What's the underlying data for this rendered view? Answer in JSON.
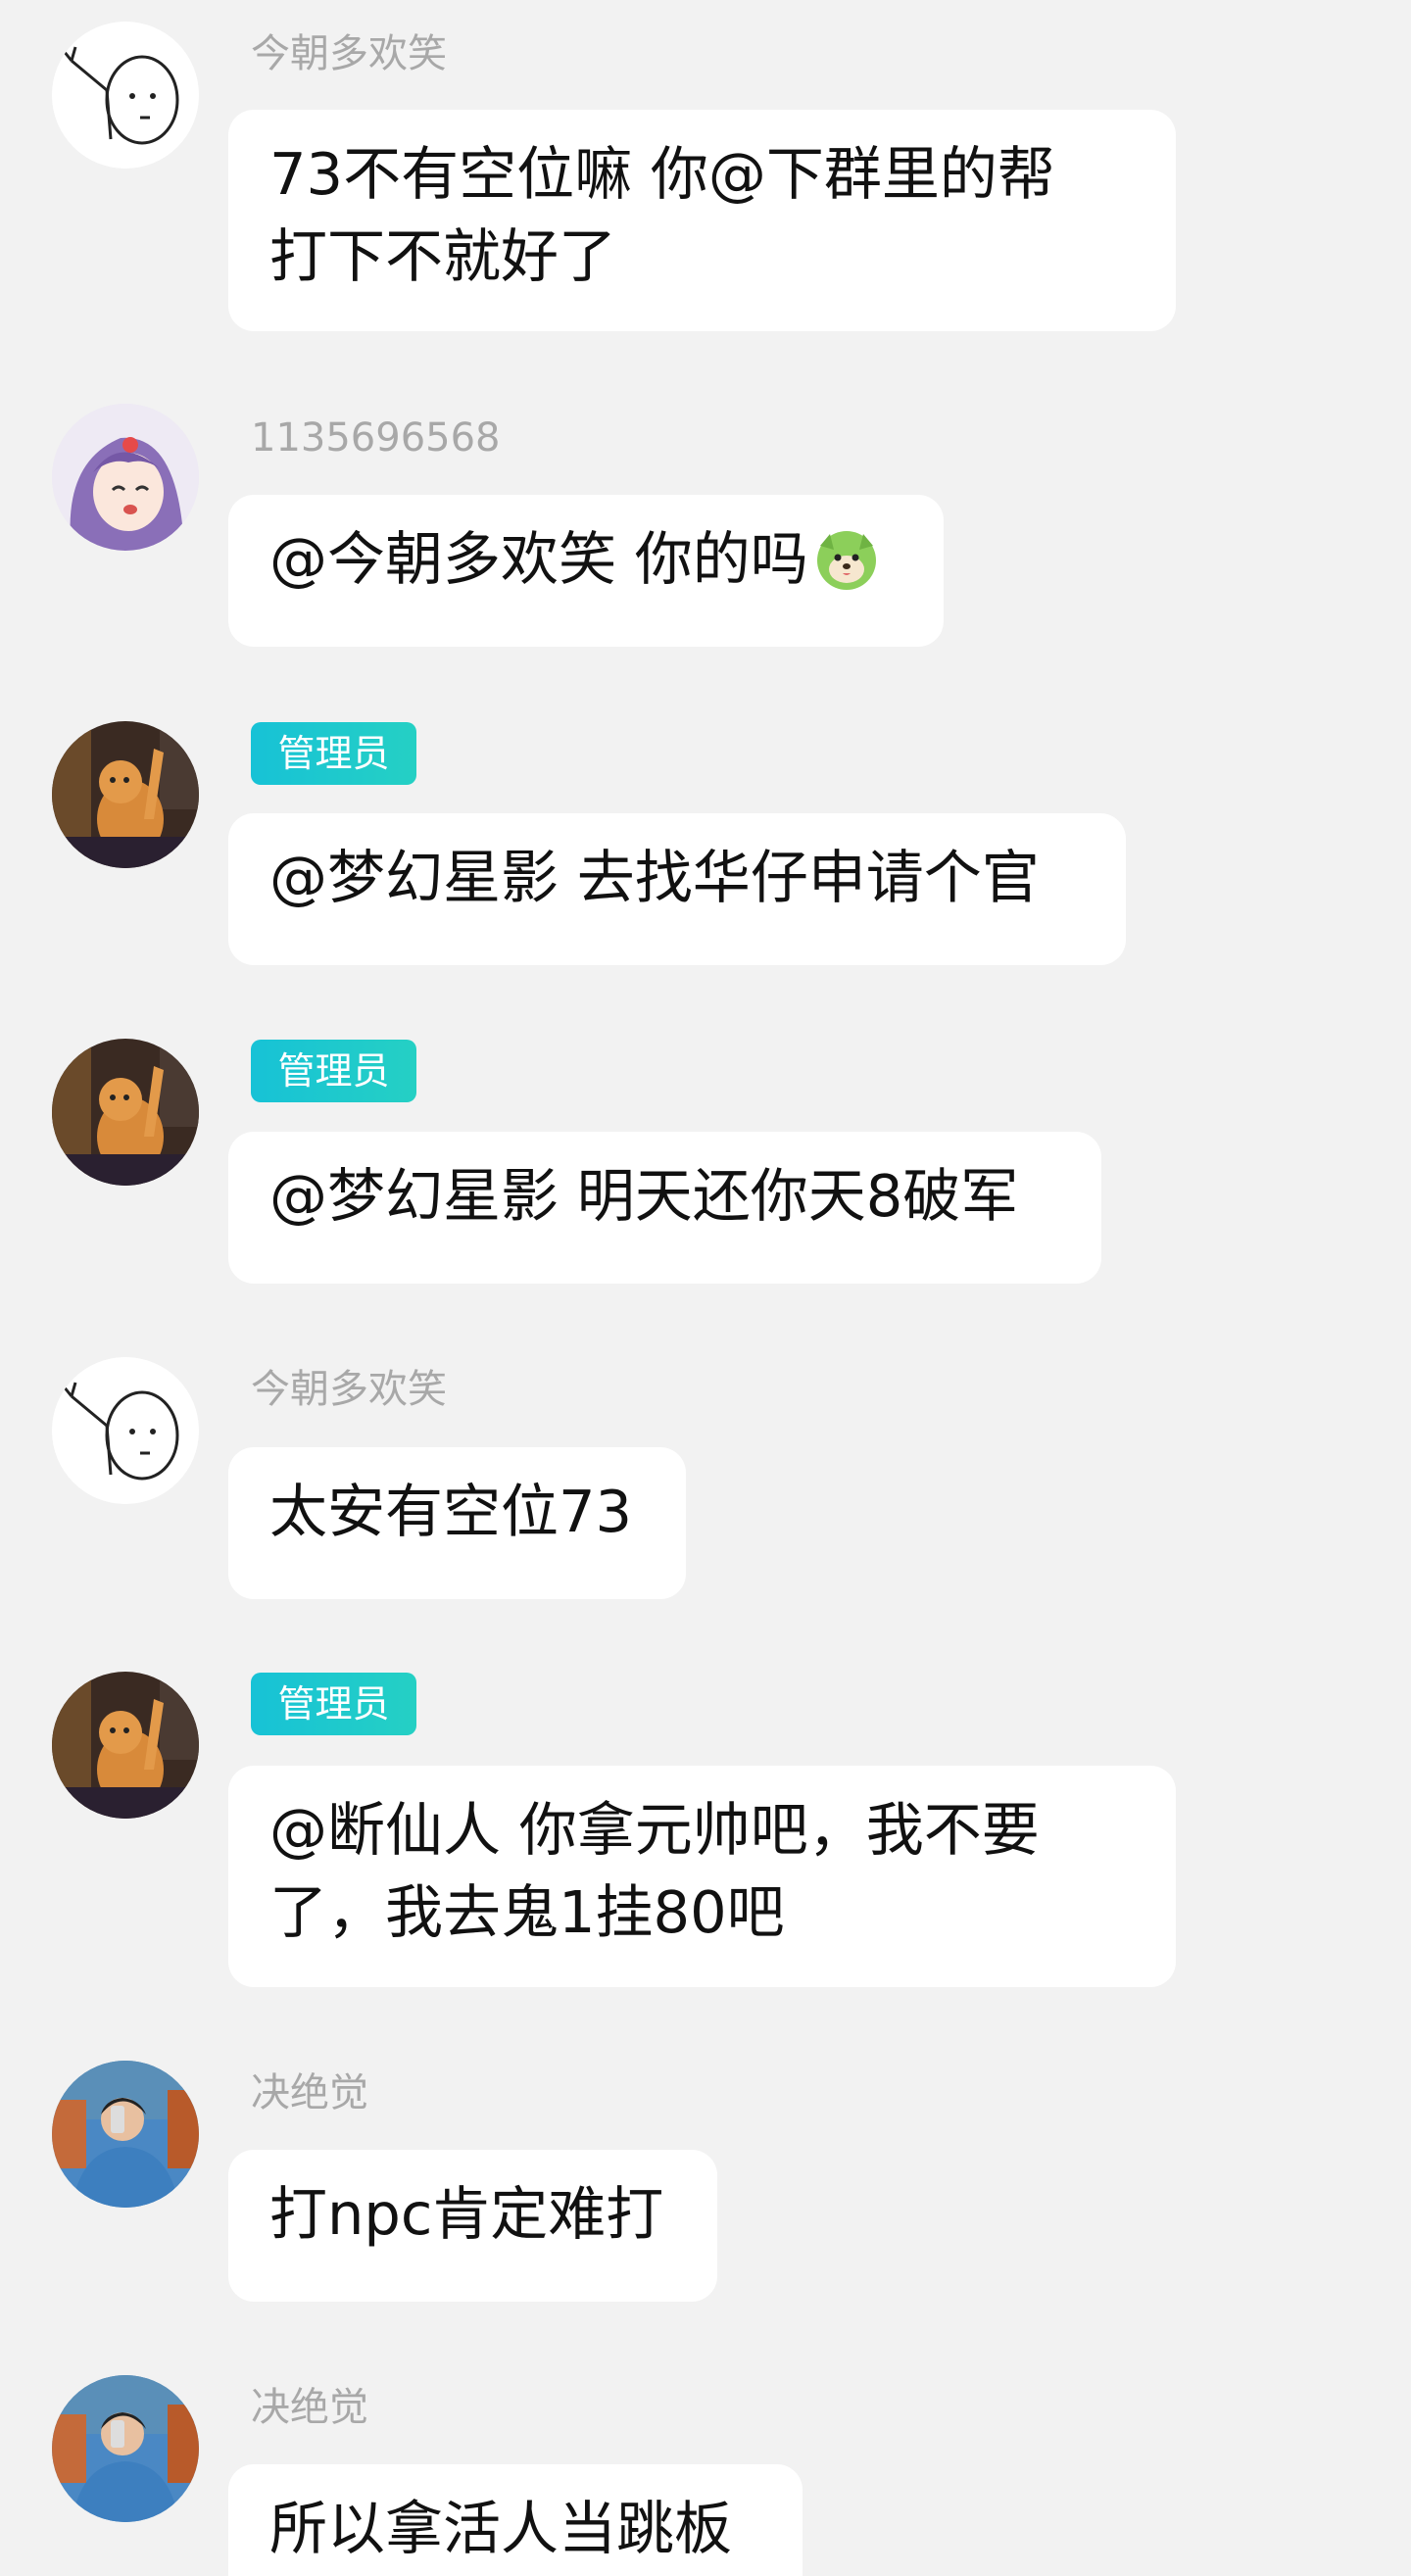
{
  "messages": [
    {
      "sender": "今朝多欢笑",
      "badge": "",
      "avatar": "doodle-avatar-icon",
      "lines": [
        "73不有空位嘛 你@下群里的帮",
        "打下不就好了"
      ]
    },
    {
      "sender": "1135696568",
      "badge": "",
      "avatar": "anime-girl-avatar-icon",
      "lines": [
        "@今朝多欢笑 你的吗"
      ],
      "emoji": "green-dog-emoji-icon"
    },
    {
      "sender": "",
      "badge": "管理员",
      "avatar": "cat-avatar-icon",
      "lines": [
        "@梦幻星影 去找华仔申请个官"
      ]
    },
    {
      "sender": "",
      "badge": "管理员",
      "avatar": "cat-avatar-icon",
      "lines": [
        "@梦幻星影 明天还你天8破军"
      ]
    },
    {
      "sender": "今朝多欢笑",
      "badge": "",
      "avatar": "doodle-avatar-icon",
      "lines": [
        "太安有空位73"
      ]
    },
    {
      "sender": "",
      "badge": "管理员",
      "avatar": "cat-avatar-icon",
      "lines": [
        "@断仙人 你拿元帅吧，我不要",
        "了，我去鬼1挂80吧"
      ]
    },
    {
      "sender": "决绝觉",
      "badge": "",
      "avatar": "person-selfie-avatar-icon",
      "lines": [
        "打npc肯定难打"
      ]
    },
    {
      "sender": "决绝觉",
      "badge": "",
      "avatar": "person-selfie-avatar-icon",
      "lines": [
        "所以拿活人当跳板"
      ]
    }
  ]
}
